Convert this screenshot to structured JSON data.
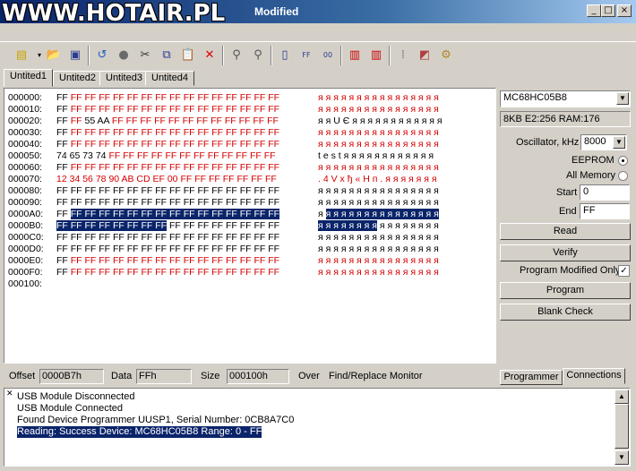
{
  "titlebar": {
    "watermark": "WWW.HOTAIR.PL",
    "title": "Modified",
    "minimize": "_",
    "maximize": "□",
    "close": "×"
  },
  "tabs": [
    {
      "label": "Untited1",
      "active": true
    },
    {
      "label": "Untited2",
      "active": false
    },
    {
      "label": "Untited3",
      "active": false
    },
    {
      "label": "Untited4",
      "active": false
    }
  ],
  "hex_rows": [
    {
      "addr": "000000:",
      "hex": "FF FF FF FF FF FF FF FF FF FF FF FF FF FF FF FF",
      "ascii": "я я я я я я я я я я я я я я я я"
    },
    {
      "addr": "000010:",
      "hex": "FF FF FF FF FF FF FF FF FF FF FF FF FF FF FF FF",
      "ascii": "я я я я я я я я я я я я я я я я"
    },
    {
      "addr": "000020:",
      "hex": "FF FF 55 AA FF FF FF FF FF FF FF FF FF FF FF FF",
      "ascii": "я я U Є я я я я я я я я я я я я"
    },
    {
      "addr": "000030:",
      "hex": "FF FF FF FF FF FF FF FF FF FF FF FF FF FF FF FF",
      "ascii": "я я я я я я я я я я я я я я я я"
    },
    {
      "addr": "000040:",
      "hex": "FF FF FF FF FF FF FF FF FF FF FF FF FF FF FF FF",
      "ascii": "я я я я я я я я я я я я я я я я"
    },
    {
      "addr": "000050:",
      "hex": "74 65 73 74 FF FF FF FF FF FF FF FF FF FF FF FF",
      "ascii": "t e s t я я я я я я я я я я я я"
    },
    {
      "addr": "000060:",
      "hex": "FF FF FF FF FF FF FF FF FF FF FF FF FF FF FF FF",
      "ascii": "я я я я я я я я я я я я я я я я"
    },
    {
      "addr": "000070:",
      "hex": "12 34 56 78 90 AB CD EF 00 FF FF FF FF FF FF FF",
      "ascii": ". 4 V x ђ « H п . я я я я я я я"
    },
    {
      "addr": "000080:",
      "hex": "FF FF FF FF FF FF FF FF FF FF FF FF FF FF FF FF",
      "ascii": "я я я я я я я я я я я я я я я я"
    },
    {
      "addr": "000090:",
      "hex": "FF FF FF FF FF FF FF FF FF FF FF FF FF FF FF FF",
      "ascii": "я я я я я я я я я я я я я я я я"
    },
    {
      "addr": "0000A0:",
      "hex": "FF FF FF FF FF FF FF FF FF FF FF FF FF FF FF FF",
      "ascii": "я я я я я я я я я я я я я я я я"
    },
    {
      "addr": "0000B0:",
      "hex": "FF FF FF FF FF FF FF FF FF FF FF FF FF FF FF FF",
      "ascii": "я я я я я я я я я я я я я я я я"
    },
    {
      "addr": "0000C0:",
      "hex": "FF FF FF FF FF FF FF FF FF FF FF FF FF FF FF FF",
      "ascii": "я я я я я я я я я я я я я я я я"
    },
    {
      "addr": "0000D0:",
      "hex": "FF FF FF FF FF FF FF FF FF FF FF FF FF FF FF FF",
      "ascii": "я я я я я я я я я я я я я я я я"
    },
    {
      "addr": "0000E0:",
      "hex": "FF FF FF FF FF FF FF FF FF FF FF FF FF FF FF FF",
      "ascii": "я я я я я я я я я я я я я я я я"
    },
    {
      "addr": "0000F0:",
      "hex": "FF FF FF FF FF FF FF FF FF FF FF FF FF FF FF FF",
      "ascii": "я я я я я я я я я я я я я я я я"
    },
    {
      "addr": "000100:",
      "hex": "",
      "ascii": ""
    }
  ],
  "device": {
    "selected": "MC68HC05B8",
    "info": "8KB E2:256 RAM:176",
    "oscillator_label": "Oscillator, kHz",
    "oscillator_value": "8000",
    "eeprom_label": "EEPROM",
    "allmemory_label": "All Memory",
    "start_label": "Start",
    "start_value": "0",
    "end_label": "End",
    "end_value": "FF",
    "read": "Read",
    "verify": "Verify",
    "program_modified_only": "Program Modified Only",
    "program": "Program",
    "blank_check": "Blank Check"
  },
  "status": {
    "offset_label": "Offset",
    "offset_value": "0000B7h",
    "data_label": "Data",
    "data_value": "FFh",
    "size_label": "Size",
    "size_value": "000100h",
    "over_label": "Over",
    "find_replace": "Find/Replace Monitor",
    "tab_programmer": "Programmer",
    "tab_connections": "Connections"
  },
  "log": [
    "USB Module Disconnected",
    "USB Module Connected",
    "Found Device Programmer UUSP1, Serial Number: 0CB8A7C0",
    "Reading: Success  Device: MC68HC05B8 Range: 0 - FF"
  ],
  "icons": {
    "new": "new-file-icon",
    "open": "open-folder-icon",
    "save": "save-icon",
    "undo": "undo-icon",
    "stop": "stop-icon",
    "cut": "cut-icon",
    "copy": "copy-icon",
    "paste": "paste-icon",
    "delete": "delete-icon"
  }
}
